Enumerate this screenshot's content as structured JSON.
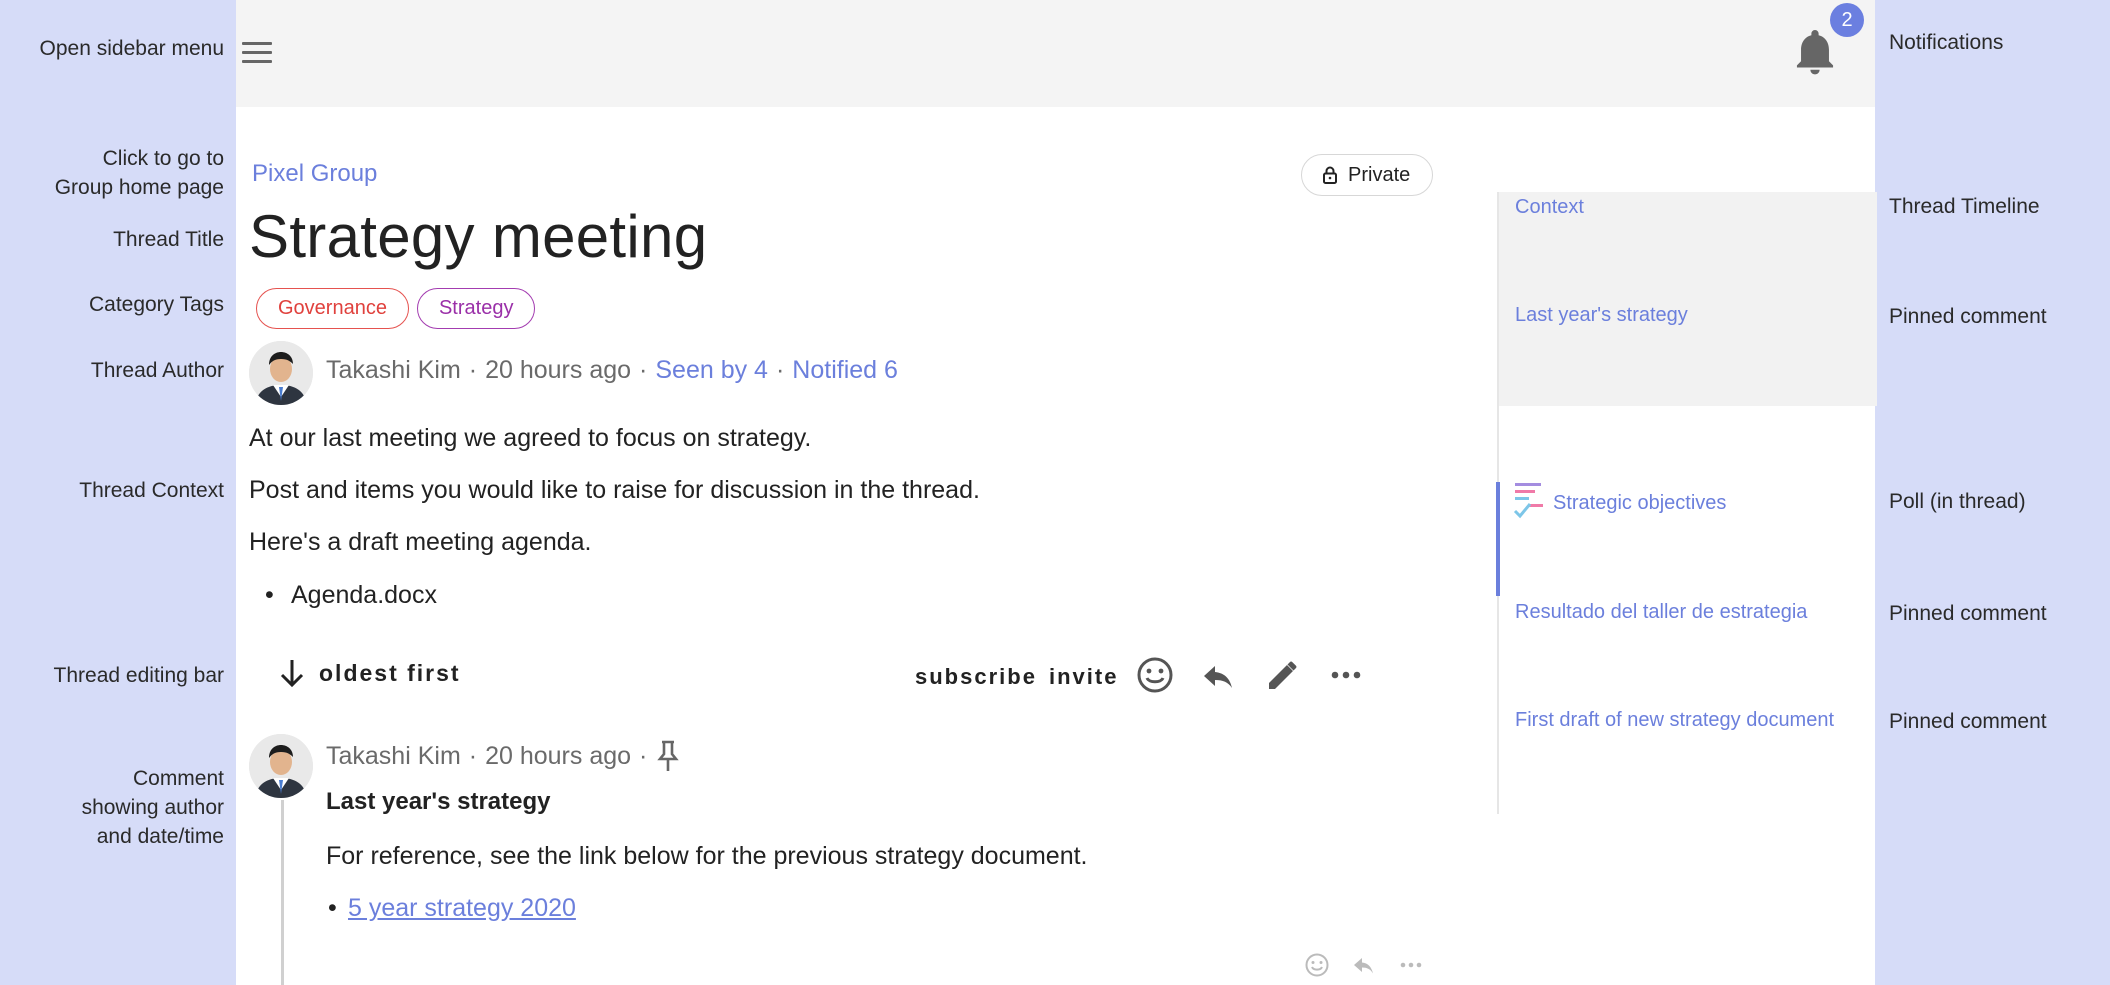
{
  "annotations": {
    "left": {
      "open_menu": "Open sidebar menu",
      "group_home_1": "Click to go to",
      "group_home_2": "Group home page",
      "thread_title": "Thread Title",
      "category_tags": "Category Tags",
      "thread_author": "Thread Author",
      "thread_context": "Thread Context",
      "editing_bar": "Thread editing bar",
      "comment_1": "Comment",
      "comment_2": "showing author",
      "comment_3": "and date/time"
    },
    "right": {
      "notifications": "Notifications",
      "timeline": "Thread Timeline",
      "pinned_1": "Pinned comment",
      "poll": "Poll (in thread)",
      "pinned_2": "Pinned comment",
      "pinned_3": "Pinned comment"
    }
  },
  "header": {
    "notification_count": "2"
  },
  "thread": {
    "group": "Pixel Group",
    "privacy": "Private",
    "title": "Strategy meeting",
    "tags": [
      "Governance",
      "Strategy"
    ],
    "author": "Takashi Kim",
    "time": "20 hours ago",
    "seen_by": "Seen by 4",
    "notified": "Notified 6",
    "context": [
      "At our last meeting we agreed to focus on strategy.",
      "Post and items you would like to raise for discussion in the thread.",
      "Here's a draft meeting agenda."
    ],
    "attachment": "Agenda.docx"
  },
  "edit_bar": {
    "order": "oldest first",
    "subscribe": "subscribe",
    "invite": "invite"
  },
  "comment": {
    "author": "Takashi Kim",
    "time": "20 hours ago",
    "title": "Last year's strategy",
    "text": "For reference, see the link below for the previous strategy document.",
    "link": "5 year strategy 2020"
  },
  "timeline": {
    "items": [
      "Context",
      "Last year's strategy",
      "Strategic objectives",
      "Resultado del taller de estrategia",
      "First draft of new strategy document"
    ]
  },
  "colors": {
    "accent": "#6b7fdc",
    "background": "#d6dcf8",
    "tag_governance": "#e0413d",
    "tag_strategy": "#9a2fa8"
  }
}
